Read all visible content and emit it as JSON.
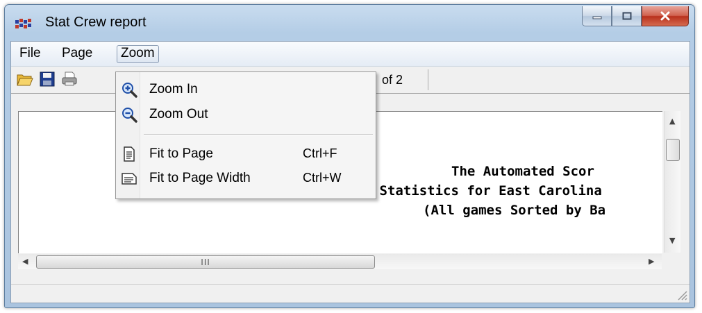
{
  "window": {
    "title": "Stat Crew report",
    "app_icon": "stat-crew-icon"
  },
  "caption_buttons": {
    "minimize_icon": "minimize-icon",
    "maximize_icon": "maximize-icon",
    "close_icon": "close-icon"
  },
  "menubar": {
    "items": [
      "File",
      "Page",
      "Zoom"
    ],
    "open_item": "Zoom"
  },
  "toolbar": {
    "icons": [
      "open-folder-icon",
      "save-icon",
      "print-icon"
    ],
    "page_suffix": "of 2"
  },
  "zoom_menu": {
    "items": [
      {
        "label": "Zoom In",
        "shortcut": "",
        "icon": "zoom-in-icon"
      },
      {
        "label": "Zoom Out",
        "shortcut": "",
        "icon": "zoom-out-icon"
      },
      {
        "label": "Fit to Page",
        "shortcut": "Ctrl+F",
        "icon": "fit-page-icon"
      },
      {
        "label": "Fit to Page Width",
        "shortcut": "Ctrl+W",
        "icon": "fit-width-icon"
      }
    ]
  },
  "report": {
    "lines": [
      "The Automated Scor",
      "Overall Statistics for East Carolina",
      "(All games Sorted by Ba"
    ]
  },
  "scrollbars": {
    "h_grip": "III"
  },
  "colors": {
    "menu_bg": "#f5f5f5",
    "frame": "#b4cde6",
    "close_button": "#c8422c"
  }
}
